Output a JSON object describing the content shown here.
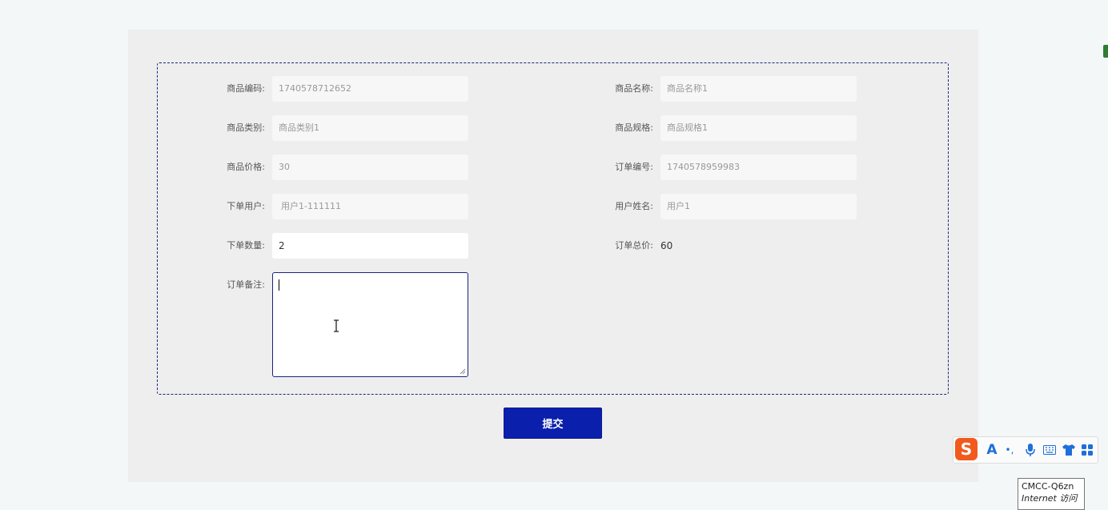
{
  "form": {
    "left": [
      {
        "label": "商品编码:",
        "value": "1740578712652",
        "editable": false
      },
      {
        "label": "商品类别:",
        "value": "商品类别1",
        "editable": false
      },
      {
        "label": "商品价格:",
        "value": "30",
        "editable": false
      },
      {
        "label": "下单用户:",
        "value": "用户1-111111",
        "editable": false
      },
      {
        "label": "下单数量:",
        "value": "2",
        "editable": true
      }
    ],
    "right": [
      {
        "label": "商品名称:",
        "value": "商品名称1"
      },
      {
        "label": "商品规格:",
        "value": "商品规格1"
      },
      {
        "label": "订单编号:",
        "value": "1740578959983"
      },
      {
        "label": "用户姓名:",
        "value": "用户1"
      },
      {
        "label": "订单总价:",
        "value": "60"
      }
    ],
    "remark_label": "订单备注:",
    "remark_value": ""
  },
  "submit_label": "提交",
  "ime_toolbar": {
    "logo": "S",
    "items": [
      "A",
      "•,",
      "mic-icon",
      "keyboard-icon",
      "shirt-icon",
      "apps-icon"
    ]
  },
  "tooltip": {
    "line1": "CMCC-Q6zn",
    "line2": "Internet 访问"
  },
  "colors": {
    "accent": "#0b1fad",
    "border": "#1a237e",
    "panel_bg": "#eeeeee",
    "page_bg": "#f3f7f7"
  }
}
